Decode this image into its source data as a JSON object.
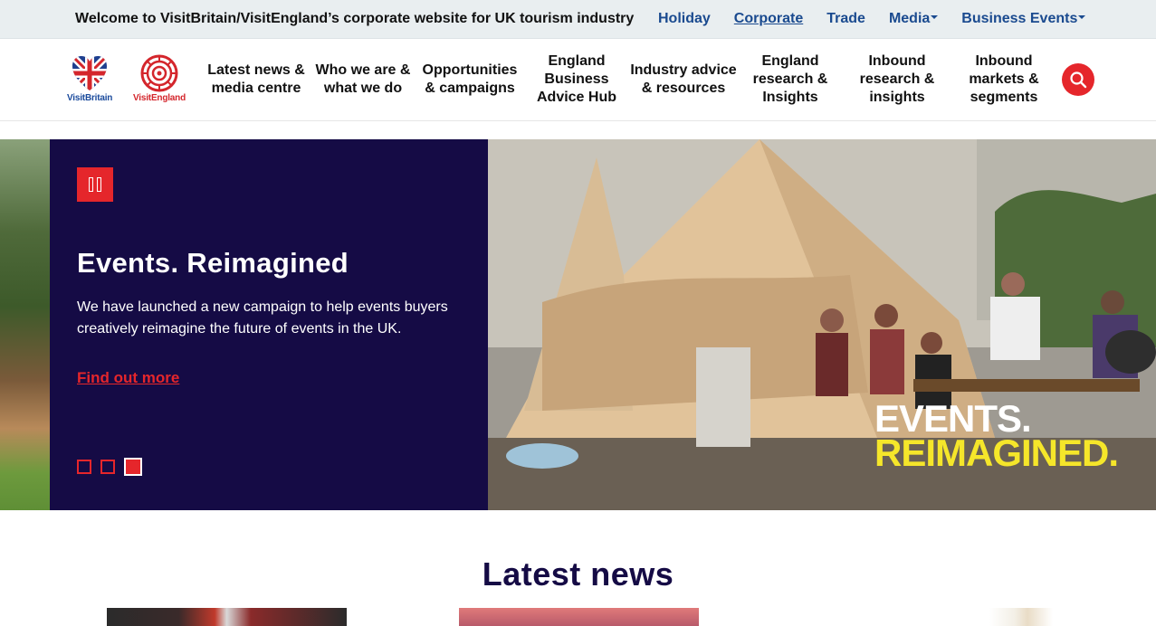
{
  "topbar": {
    "welcome": "Welcome to VisitBritain/VisitEngland’s corporate website for UK tourism industry",
    "sites": [
      {
        "label": "Holiday",
        "active": false,
        "dropdown": false
      },
      {
        "label": "Corporate",
        "active": true,
        "dropdown": false
      },
      {
        "label": "Trade",
        "active": false,
        "dropdown": false
      },
      {
        "label": "Media",
        "active": false,
        "dropdown": true
      },
      {
        "label": "Business Events",
        "active": false,
        "dropdown": true
      }
    ]
  },
  "logos": {
    "visitbritain": "VisitBritain",
    "visitengland": "VisitEngland"
  },
  "nav": {
    "items": [
      "Latest news & media centre",
      "Who we are & what we do",
      "Opportunities & campaigns",
      "England Business Advice Hub",
      "Industry advice & resources",
      "England research & Insights",
      "Inbound research & insights",
      "Inbound markets & segments"
    ],
    "search_icon": "search-icon"
  },
  "hero": {
    "title": "Events. Reimagined",
    "description": "We have launched a new campaign to help events buyers creatively reimagine the future of events in the UK.",
    "link": "Find out more",
    "pause_icon": "pause-icon",
    "slides": 3,
    "active_slide": 3,
    "photo_text_line1": "EVENTS.",
    "photo_text_line2": "REIMAGINED."
  },
  "news": {
    "heading": "Latest news"
  },
  "colors": {
    "brand_red": "#e5262b",
    "navy": "#150b45",
    "link_blue": "#1a4a8f",
    "highlight_yellow": "#f5e62a"
  }
}
